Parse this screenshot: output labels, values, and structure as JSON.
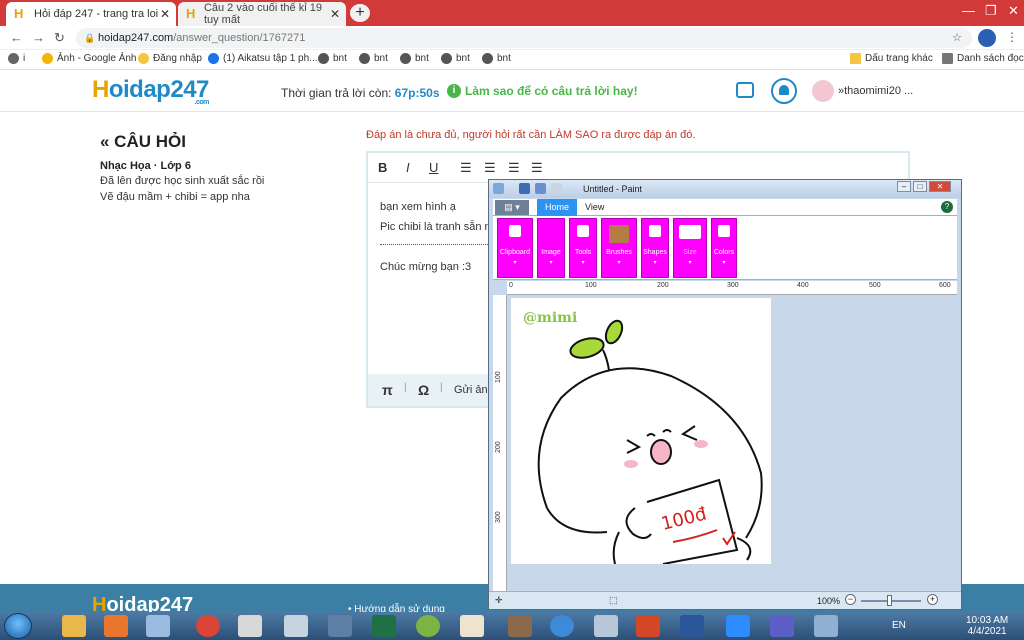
{
  "browser": {
    "tabs": [
      {
        "title": "Hỏi đáp 247 - trang tra loi"
      },
      {
        "title": "Câu 2 vào cuối thế kỉ 19 tuy mất"
      }
    ],
    "url_host": "hoidap247.com",
    "url_path": "/answer_question/1767271",
    "bookmarks": [
      "Ảnh - Google Ảnh",
      "Đăng nhập",
      "(1) Aikatsu tập 1 ph...",
      "bnt",
      "bnt",
      "bnt",
      "bnt",
      "bnt",
      "Dấu trang khác",
      "Danh sách đọc"
    ]
  },
  "site": {
    "logo_h": "H",
    "logo_rest": "oidap247",
    "logo_dotcom": ".com",
    "timer_label": "Thời gian trả lời còn:",
    "timer_value": "67p:50s",
    "tip": "Làm sao để có câu trả lời hay!",
    "username": "thaomimi20 ..."
  },
  "question": {
    "heading": "« CÂU HỎI",
    "subject": "Nhạc Họa · Lớp 6",
    "line1": "Đã lên được học sinh xuất sắc rồi",
    "line2": "Vẽ đậu mầm + chibi = app nha"
  },
  "warning": "Đáp án là chưa đủ, người hỏi rất cần LÀM SAO ra được đáp án đó.",
  "editor": {
    "toolbar": [
      "B",
      "I",
      "U"
    ],
    "lines": [
      "bạn xem hình ạ",
      "Pic chibi là tranh sẵn n",
      "Chúc mừng bạn :3"
    ],
    "bottom_tools": [
      "π",
      "Ω"
    ],
    "send_image": "Gửi ảnh"
  },
  "footer": {
    "logo_h": "H",
    "logo_rest": "oidap247",
    "link": "• Hướng dẫn sử dụng"
  },
  "paint": {
    "title": "Untitled - Paint",
    "tabs": [
      "Home",
      "View"
    ],
    "groups": [
      "Clipboard",
      "Image",
      "Tools",
      "Brushes",
      "Shapes",
      "Size",
      "Colors"
    ],
    "ruler_h": [
      "0",
      "100",
      "200",
      "300",
      "400",
      "500",
      "600"
    ],
    "ruler_v": [
      "100",
      "200",
      "300"
    ],
    "watermark": "@mimi",
    "paper_text": "100đ",
    "zoom": "100%"
  },
  "taskbar": {
    "lang": "EN",
    "time": "10:03 AM",
    "date": "4/4/2021"
  },
  "colors": {
    "tab_strip": "#d23a3a",
    "site_blue": "#1f8ac7",
    "logo_yellow": "#e7a400",
    "tip_green": "#48b748",
    "warning_red": "#c0392b",
    "ribbon_magenta": "#ff00ff"
  }
}
